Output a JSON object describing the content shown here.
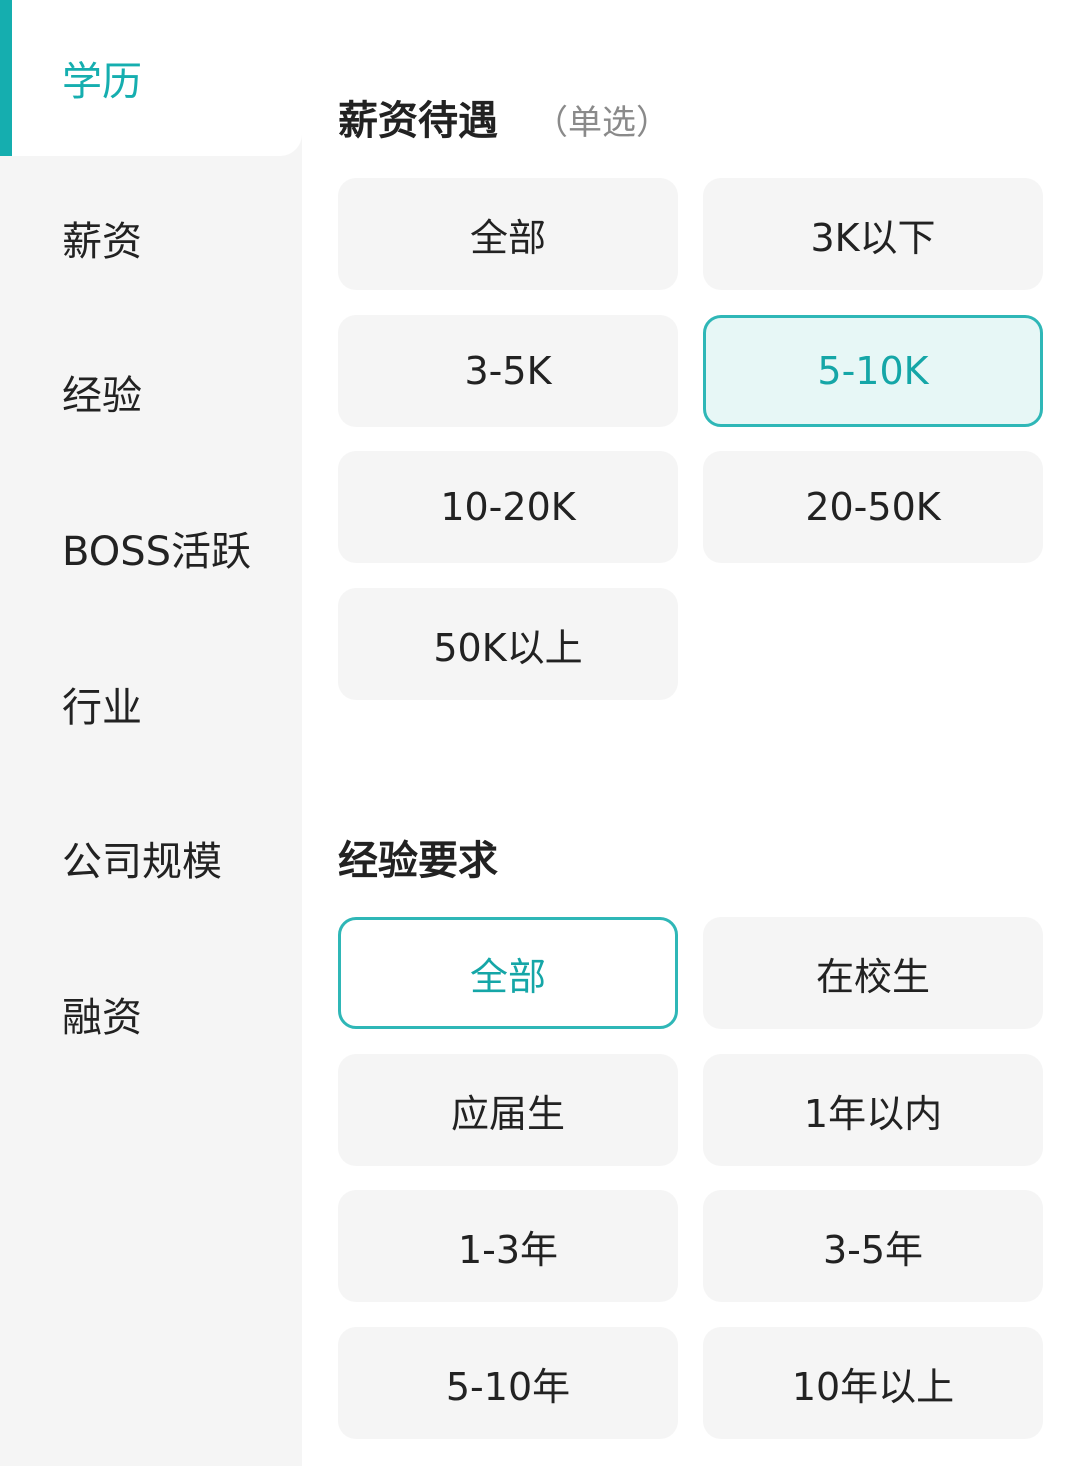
{
  "sidebar": {
    "items": [
      {
        "label": "学历",
        "active": true
      },
      {
        "label": "薪资"
      },
      {
        "label": "经验"
      },
      {
        "label": "BOSS活跃"
      },
      {
        "label": "行业"
      },
      {
        "label": "公司规模"
      },
      {
        "label": "融资"
      }
    ]
  },
  "salary": {
    "title": "薪资待遇",
    "subtitle": "（单选）",
    "options": [
      "全部",
      "3K以下",
      "3-5K",
      "5-10K",
      "10-20K",
      "20-50K",
      "50K以上"
    ],
    "selected": "5-10K"
  },
  "experience": {
    "title": "经验要求",
    "options": [
      "全部",
      "在校生",
      "应届生",
      "1年以内",
      "1-3年",
      "3-5年",
      "5-10年",
      "10年以上"
    ],
    "selected": "全部"
  },
  "colors": {
    "accent": "#15aeaf",
    "selected_fill": "#e7f7f6",
    "chip_background": "#f5f5f5",
    "sidebar_background": "#f5f5f5"
  }
}
